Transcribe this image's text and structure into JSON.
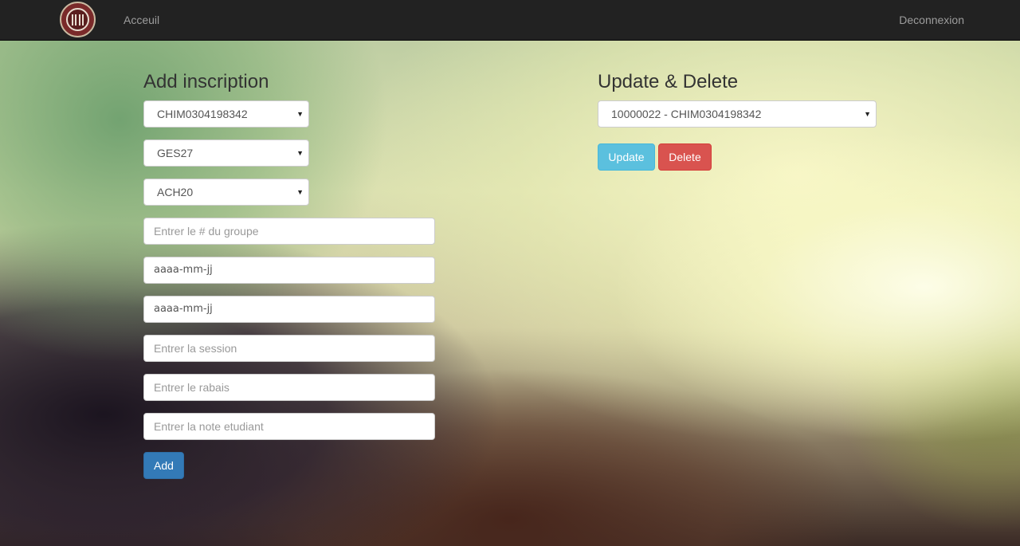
{
  "nav": {
    "home": "Acceuil",
    "logout": "Deconnexion"
  },
  "add_form": {
    "title": "Add inscription",
    "student_select": "CHIM0304198342",
    "course_select": "GES27",
    "teacher_select": "ACH20",
    "group_placeholder": "Entrer le # du groupe",
    "start_date_value": "aaaa-mm-jj",
    "end_date_value": "aaaa-mm-jj",
    "session_placeholder": "Entrer la session",
    "rabais_placeholder": "Entrer le rabais",
    "note_placeholder": "Entrer la note etudiant",
    "add_label": "Add"
  },
  "update_form": {
    "title": "Update & Delete",
    "record_select": "10000022 - CHIM0304198342",
    "update_label": "Update",
    "delete_label": "Delete"
  },
  "caret_glyph": "▼",
  "colors": {
    "navbar": "#222222",
    "nav_text": "#9d9d9d",
    "primary": "#337ab7",
    "info": "#5bc0de",
    "danger": "#d9534f"
  }
}
